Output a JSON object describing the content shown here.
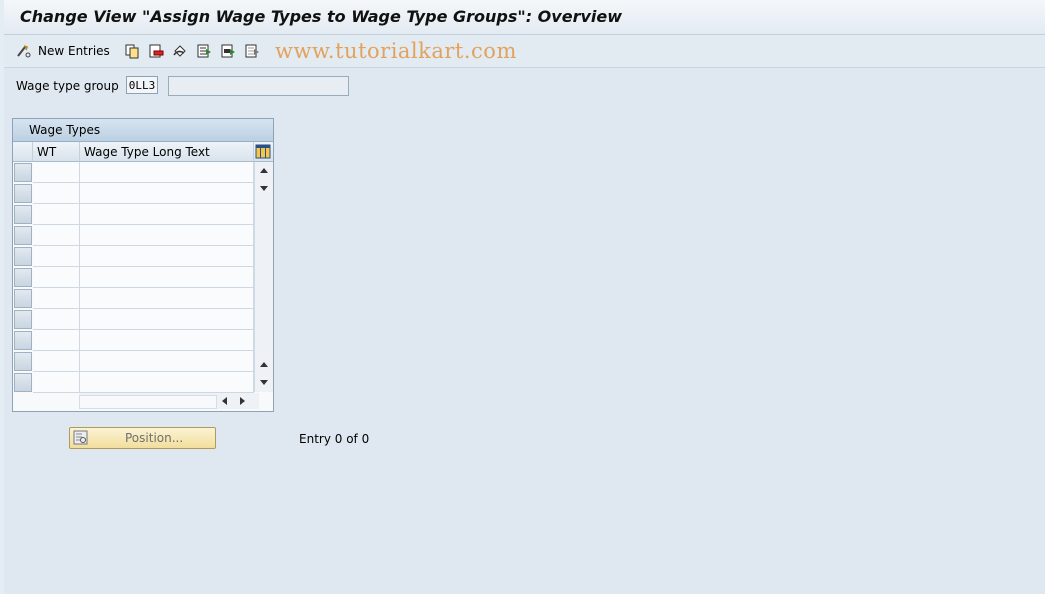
{
  "window": {
    "title": "Change View \"Assign Wage Types to Wage Type Groups\": Overview"
  },
  "toolbar": {
    "new_entries_label": "New Entries",
    "icons": [
      "pencil-glasses-icon",
      "copy-icon",
      "delete-icon",
      "undo-icon",
      "select-all-icon",
      "select-block-icon",
      "deselect-all-icon"
    ]
  },
  "watermark": "www.tutorialkart.com",
  "filter": {
    "label": "Wage type group",
    "value": "0LL3",
    "description": ""
  },
  "table": {
    "title": "Wage Types",
    "columns": [
      "WT",
      "Wage Type Long Text"
    ],
    "visible_rows": 11,
    "rows": []
  },
  "footer": {
    "position_label": "Position...",
    "entry_text": "Entry 0 of 0"
  },
  "colors": {
    "background": "#dfe8f0",
    "watermark": "#e3a25c",
    "button": "#f2de9c"
  }
}
